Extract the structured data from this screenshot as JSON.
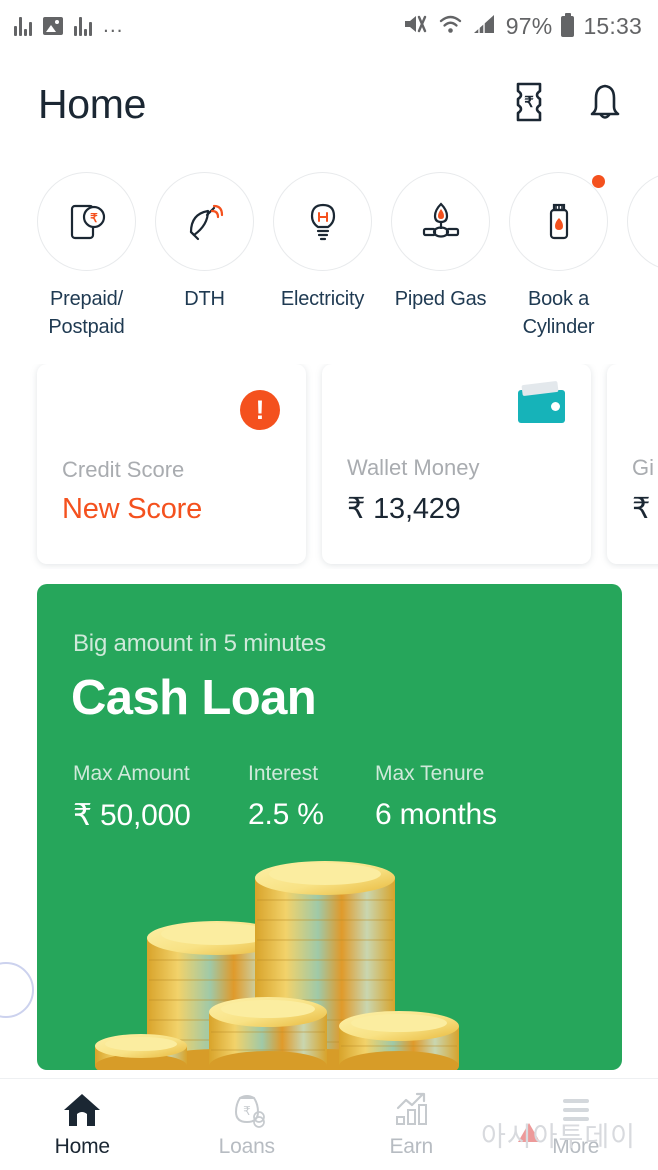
{
  "status_bar": {
    "left_icons": [
      "equalizer-icon",
      "image-icon",
      "equalizer-icon",
      "overflow-dots-icon"
    ],
    "dots": "...",
    "mute_icon": "mute-icon",
    "wifi_icon": "wifi-icon",
    "signal_icon": "signal-icon",
    "battery_percent": "97%",
    "time": "15:33"
  },
  "header": {
    "title": "Home",
    "voucher_icon": "rupee-voucher-icon",
    "bell_icon": "notification-bell-icon"
  },
  "services": [
    {
      "label": "Prepaid/\nPostpaid",
      "label_line1": "Prepaid/",
      "label_line2": "Postpaid",
      "icon": "mobile-recharge-icon",
      "badge": false
    },
    {
      "label": "DTH",
      "label_line1": "DTH",
      "label_line2": "",
      "icon": "satellite-dish-icon",
      "badge": false
    },
    {
      "label": "Electricity",
      "label_line1": "Electricity",
      "label_line2": "",
      "icon": "light-bulb-icon",
      "badge": false
    },
    {
      "label": "Piped Gas",
      "label_line1": "Piped Gas",
      "label_line2": "",
      "icon": "gas-burner-icon",
      "badge": false
    },
    {
      "label": "Book a\nCylinder",
      "label_line1": "Book a",
      "label_line2": "Cylinder",
      "icon": "gas-cylinder-icon",
      "badge": true
    },
    {
      "label": "",
      "label_line1": "",
      "label_line2": "",
      "icon": "more-service-icon",
      "badge": false
    }
  ],
  "cards": [
    {
      "label": "Credit Score",
      "value": "New Score",
      "icon": "alert-exclamation-icon",
      "value_style": "alert"
    },
    {
      "label": "Wallet Money",
      "value": "₹ 13,429",
      "icon": "wallet-icon",
      "value_style": "normal"
    },
    {
      "label": "Gi",
      "value": "₹",
      "icon": "gift-icon",
      "value_style": "normal"
    }
  ],
  "loan_banner": {
    "subtitle": "Big amount in 5 minutes",
    "title": "Cash Loan",
    "stats": [
      {
        "label": "Max Amount",
        "value": "₹ 50,000"
      },
      {
        "label": "Interest",
        "value": "2.5 %"
      },
      {
        "label": "Max Tenure",
        "value": "6 months"
      }
    ],
    "illustration": "gold-coin-stacks"
  },
  "bottom_nav": [
    {
      "label": "Home",
      "icon": "home-icon",
      "active": true
    },
    {
      "label": "Loans",
      "icon": "money-bag-icon",
      "active": false
    },
    {
      "label": "Earn",
      "icon": "growth-chart-icon",
      "active": false
    },
    {
      "label": "More",
      "icon": "hamburger-menu-icon",
      "active": false
    }
  ],
  "watermark": {
    "text": "아시아투데이"
  },
  "colors": {
    "accent_orange": "#f4511e",
    "banner_green": "#26a65b",
    "wallet_teal": "#16b3b9",
    "label_navy": "#1f3a52",
    "text_dark": "#1b2733",
    "muted_gray": "#a9acb0"
  }
}
